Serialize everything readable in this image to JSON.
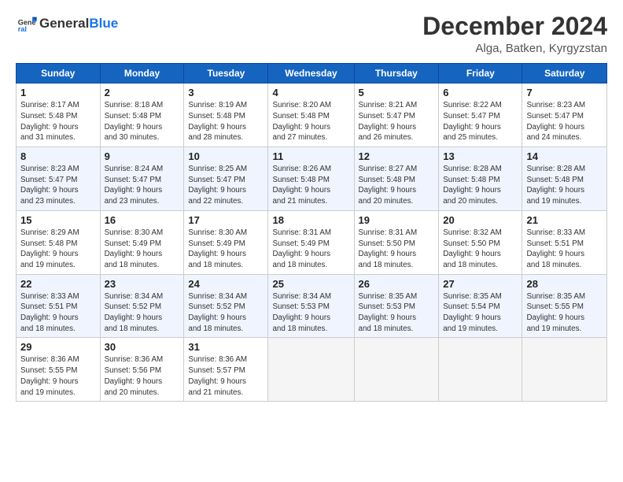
{
  "header": {
    "logo_general": "General",
    "logo_blue": "Blue",
    "month_title": "December 2024",
    "location": "Alga, Batken, Kyrgyzstan"
  },
  "days_of_week": [
    "Sunday",
    "Monday",
    "Tuesday",
    "Wednesday",
    "Thursday",
    "Friday",
    "Saturday"
  ],
  "weeks": [
    [
      {
        "day": 1,
        "info": "Sunrise: 8:17 AM\nSunset: 5:48 PM\nDaylight: 9 hours\nand 31 minutes."
      },
      {
        "day": 2,
        "info": "Sunrise: 8:18 AM\nSunset: 5:48 PM\nDaylight: 9 hours\nand 30 minutes."
      },
      {
        "day": 3,
        "info": "Sunrise: 8:19 AM\nSunset: 5:48 PM\nDaylight: 9 hours\nand 28 minutes."
      },
      {
        "day": 4,
        "info": "Sunrise: 8:20 AM\nSunset: 5:48 PM\nDaylight: 9 hours\nand 27 minutes."
      },
      {
        "day": 5,
        "info": "Sunrise: 8:21 AM\nSunset: 5:47 PM\nDaylight: 9 hours\nand 26 minutes."
      },
      {
        "day": 6,
        "info": "Sunrise: 8:22 AM\nSunset: 5:47 PM\nDaylight: 9 hours\nand 25 minutes."
      },
      {
        "day": 7,
        "info": "Sunrise: 8:23 AM\nSunset: 5:47 PM\nDaylight: 9 hours\nand 24 minutes."
      }
    ],
    [
      {
        "day": 8,
        "info": "Sunrise: 8:23 AM\nSunset: 5:47 PM\nDaylight: 9 hours\nand 23 minutes."
      },
      {
        "day": 9,
        "info": "Sunrise: 8:24 AM\nSunset: 5:47 PM\nDaylight: 9 hours\nand 23 minutes."
      },
      {
        "day": 10,
        "info": "Sunrise: 8:25 AM\nSunset: 5:47 PM\nDaylight: 9 hours\nand 22 minutes."
      },
      {
        "day": 11,
        "info": "Sunrise: 8:26 AM\nSunset: 5:48 PM\nDaylight: 9 hours\nand 21 minutes."
      },
      {
        "day": 12,
        "info": "Sunrise: 8:27 AM\nSunset: 5:48 PM\nDaylight: 9 hours\nand 20 minutes."
      },
      {
        "day": 13,
        "info": "Sunrise: 8:28 AM\nSunset: 5:48 PM\nDaylight: 9 hours\nand 20 minutes."
      },
      {
        "day": 14,
        "info": "Sunrise: 8:28 AM\nSunset: 5:48 PM\nDaylight: 9 hours\nand 19 minutes."
      }
    ],
    [
      {
        "day": 15,
        "info": "Sunrise: 8:29 AM\nSunset: 5:48 PM\nDaylight: 9 hours\nand 19 minutes."
      },
      {
        "day": 16,
        "info": "Sunrise: 8:30 AM\nSunset: 5:49 PM\nDaylight: 9 hours\nand 18 minutes."
      },
      {
        "day": 17,
        "info": "Sunrise: 8:30 AM\nSunset: 5:49 PM\nDaylight: 9 hours\nand 18 minutes."
      },
      {
        "day": 18,
        "info": "Sunrise: 8:31 AM\nSunset: 5:49 PM\nDaylight: 9 hours\nand 18 minutes."
      },
      {
        "day": 19,
        "info": "Sunrise: 8:31 AM\nSunset: 5:50 PM\nDaylight: 9 hours\nand 18 minutes."
      },
      {
        "day": 20,
        "info": "Sunrise: 8:32 AM\nSunset: 5:50 PM\nDaylight: 9 hours\nand 18 minutes."
      },
      {
        "day": 21,
        "info": "Sunrise: 8:33 AM\nSunset: 5:51 PM\nDaylight: 9 hours\nand 18 minutes."
      }
    ],
    [
      {
        "day": 22,
        "info": "Sunrise: 8:33 AM\nSunset: 5:51 PM\nDaylight: 9 hours\nand 18 minutes."
      },
      {
        "day": 23,
        "info": "Sunrise: 8:34 AM\nSunset: 5:52 PM\nDaylight: 9 hours\nand 18 minutes."
      },
      {
        "day": 24,
        "info": "Sunrise: 8:34 AM\nSunset: 5:52 PM\nDaylight: 9 hours\nand 18 minutes."
      },
      {
        "day": 25,
        "info": "Sunrise: 8:34 AM\nSunset: 5:53 PM\nDaylight: 9 hours\nand 18 minutes."
      },
      {
        "day": 26,
        "info": "Sunrise: 8:35 AM\nSunset: 5:53 PM\nDaylight: 9 hours\nand 18 minutes."
      },
      {
        "day": 27,
        "info": "Sunrise: 8:35 AM\nSunset: 5:54 PM\nDaylight: 9 hours\nand 19 minutes."
      },
      {
        "day": 28,
        "info": "Sunrise: 8:35 AM\nSunset: 5:55 PM\nDaylight: 9 hours\nand 19 minutes."
      }
    ],
    [
      {
        "day": 29,
        "info": "Sunrise: 8:36 AM\nSunset: 5:55 PM\nDaylight: 9 hours\nand 19 minutes."
      },
      {
        "day": 30,
        "info": "Sunrise: 8:36 AM\nSunset: 5:56 PM\nDaylight: 9 hours\nand 20 minutes."
      },
      {
        "day": 31,
        "info": "Sunrise: 8:36 AM\nSunset: 5:57 PM\nDaylight: 9 hours\nand 21 minutes."
      },
      null,
      null,
      null,
      null
    ]
  ]
}
